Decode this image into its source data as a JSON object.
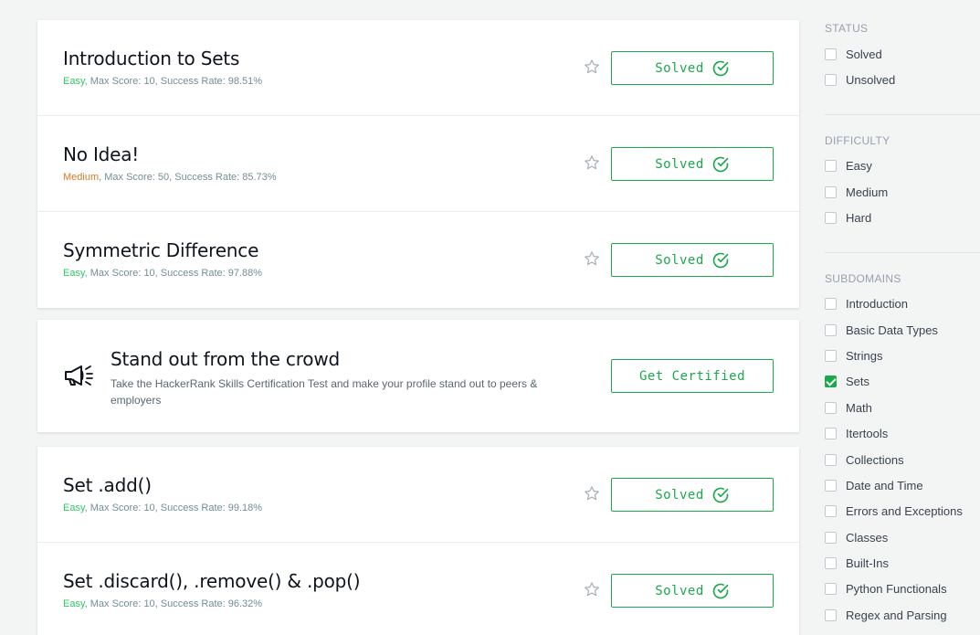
{
  "challenges_top": [
    {
      "title": "Introduction to Sets",
      "difficulty": "Easy",
      "difficulty_class": "easy",
      "rest": ", Max Score: 10, Success Rate: 98.51%",
      "status": "Solved"
    },
    {
      "title": "No Idea!",
      "difficulty": "Medium",
      "difficulty_class": "medium",
      "rest": ", Max Score: 50, Success Rate: 85.73%",
      "status": "Solved"
    },
    {
      "title": "Symmetric Difference",
      "difficulty": "Easy",
      "difficulty_class": "easy",
      "rest": ", Max Score: 10, Success Rate: 97.88%",
      "status": "Solved"
    }
  ],
  "promo": {
    "title": "Stand out from the crowd",
    "description": "Take the HackerRank Skills Certification Test and make your profile stand out to peers & employers",
    "button": "Get Certified",
    "icon": "megaphone-icon"
  },
  "challenges_bottom": [
    {
      "title": "Set .add()",
      "difficulty": "Easy",
      "difficulty_class": "easy",
      "rest": ", Max Score: 10, Success Rate: 99.18%",
      "status": "Solved"
    },
    {
      "title": "Set .discard(), .remove() & .pop()",
      "difficulty": "Easy",
      "difficulty_class": "easy",
      "rest": ", Max Score: 10, Success Rate: 96.32%",
      "status": "Solved"
    }
  ],
  "filters": {
    "status": {
      "title": "STATUS",
      "options": [
        {
          "label": "Solved",
          "checked": false
        },
        {
          "label": "Unsolved",
          "checked": false
        }
      ]
    },
    "difficulty": {
      "title": "DIFFICULTY",
      "options": [
        {
          "label": "Easy",
          "checked": false
        },
        {
          "label": "Medium",
          "checked": false
        },
        {
          "label": "Hard",
          "checked": false
        }
      ]
    },
    "subdomains": {
      "title": "SUBDOMAINS",
      "options": [
        {
          "label": "Introduction",
          "checked": false
        },
        {
          "label": "Basic Data Types",
          "checked": false
        },
        {
          "label": "Strings",
          "checked": false
        },
        {
          "label": "Sets",
          "checked": true
        },
        {
          "label": "Math",
          "checked": false
        },
        {
          "label": "Itertools",
          "checked": false
        },
        {
          "label": "Collections",
          "checked": false
        },
        {
          "label": "Date and Time",
          "checked": false
        },
        {
          "label": "Errors and Exceptions",
          "checked": false
        },
        {
          "label": "Classes",
          "checked": false
        },
        {
          "label": "Built-Ins",
          "checked": false
        },
        {
          "label": "Python Functionals",
          "checked": false
        },
        {
          "label": "Regex and Parsing",
          "checked": false
        }
      ]
    }
  },
  "colors": {
    "accent": "#1ba94c",
    "easy": "#2ec866",
    "medium": "#d97a25"
  },
  "icons": {
    "star": "star-icon",
    "solved": "check-circle-icon"
  }
}
